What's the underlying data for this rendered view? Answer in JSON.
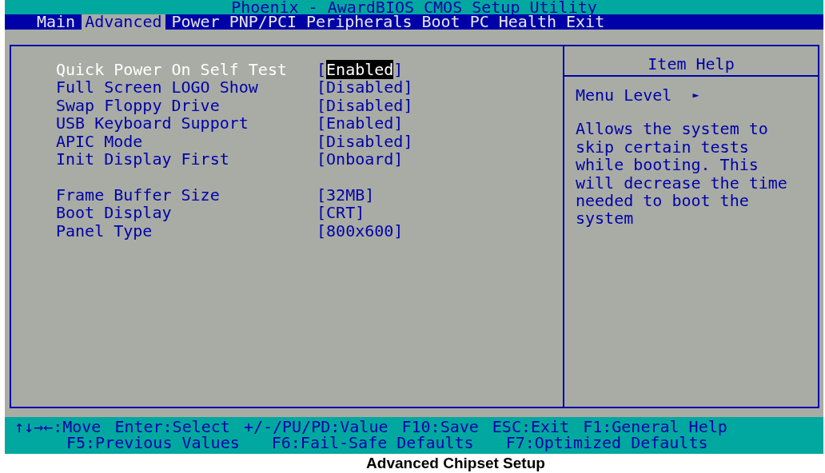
{
  "window": {
    "title": "Phoenix - AwardBIOS CMOS Setup Utility"
  },
  "tabs": [
    {
      "label": "Main",
      "selected": false
    },
    {
      "label": "Advanced",
      "selected": true
    },
    {
      "label": "Power",
      "selected": false
    },
    {
      "label": "PNP/PCI",
      "selected": false
    },
    {
      "label": "Peripherals",
      "selected": false
    },
    {
      "label": "Boot",
      "selected": false
    },
    {
      "label": "PC Health",
      "selected": false
    },
    {
      "label": "Exit",
      "selected": false
    }
  ],
  "settings": [
    {
      "name": "Quick Power On Self Test",
      "value": "Enabled",
      "selected": true
    },
    {
      "name": "Full Screen LOGO Show",
      "value": "Disabled",
      "selected": false
    },
    {
      "name": "Swap Floppy Drive",
      "value": "Disabled",
      "selected": false
    },
    {
      "name": "USB Keyboard Support",
      "value": "Enabled",
      "selected": false
    },
    {
      "name": "APIC Mode",
      "value": "Disabled",
      "selected": false
    },
    {
      "name": "Init Display First",
      "value": "Onboard",
      "selected": false
    },
    {
      "kind": "gap"
    },
    {
      "name": "Frame Buffer Size",
      "value": "32MB",
      "selected": false
    },
    {
      "name": "Boot Display",
      "value": "CRT",
      "selected": false
    },
    {
      "name": "Panel Type",
      "value": "800x600",
      "selected": false
    }
  ],
  "bracket_open": "[",
  "bracket_close": "]",
  "help": {
    "title": "Item Help",
    "menu_level": "Menu Level",
    "menu_level_marker": "►",
    "text": "Allows the system to skip certain tests while booting. This will decrease the time needed to boot the system"
  },
  "status_bar": [
    [
      "↑↓→←:Move",
      "Enter:Select",
      "+/-/PU/PD:Value",
      "F10:Save",
      "ESC:Exit",
      "F1:General Help"
    ],
    [
      "F5:Previous Values",
      "F6:Fail-Safe Defaults",
      "F7:Optimized Defaults"
    ]
  ],
  "caption": "Advanced Chipset Setup"
}
